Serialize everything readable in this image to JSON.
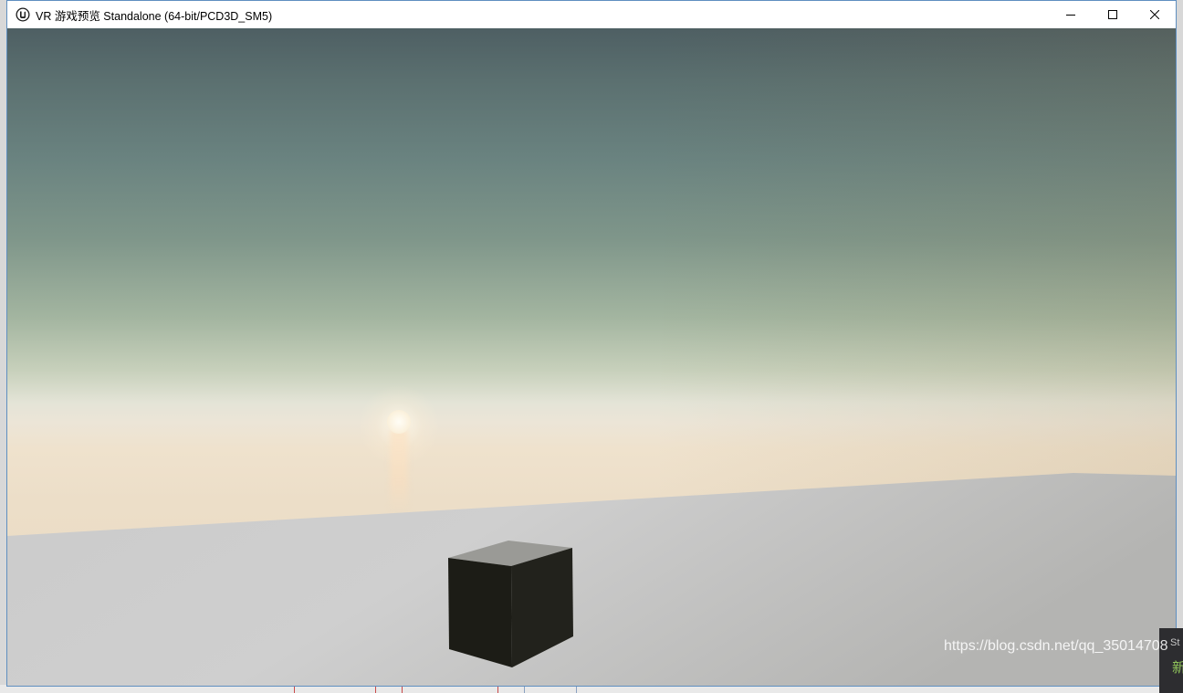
{
  "window": {
    "title": "VR 游戏预览 Standalone (64-bit/PCD3D_SM5)",
    "app_icon": "unreal-engine-logo-icon",
    "controls": {
      "minimize_icon": "minimize-icon",
      "maximize_icon": "maximize-icon",
      "close_icon": "close-icon"
    }
  },
  "scene": {
    "description_objects": [
      "sky-gradient",
      "sun",
      "ground-plane",
      "dark-cube"
    ]
  },
  "watermark": {
    "text": "https://blog.csdn.net/qq_35014708"
  },
  "background_panel": {
    "text_top": "St",
    "text_bottom": "新"
  },
  "colors": {
    "window_border": "#5f8fc0",
    "cube_face": "#1c1c16",
    "ground": "#c9c9c9",
    "sky_top": "#4e5f63",
    "horizon": "#ece5d7"
  }
}
